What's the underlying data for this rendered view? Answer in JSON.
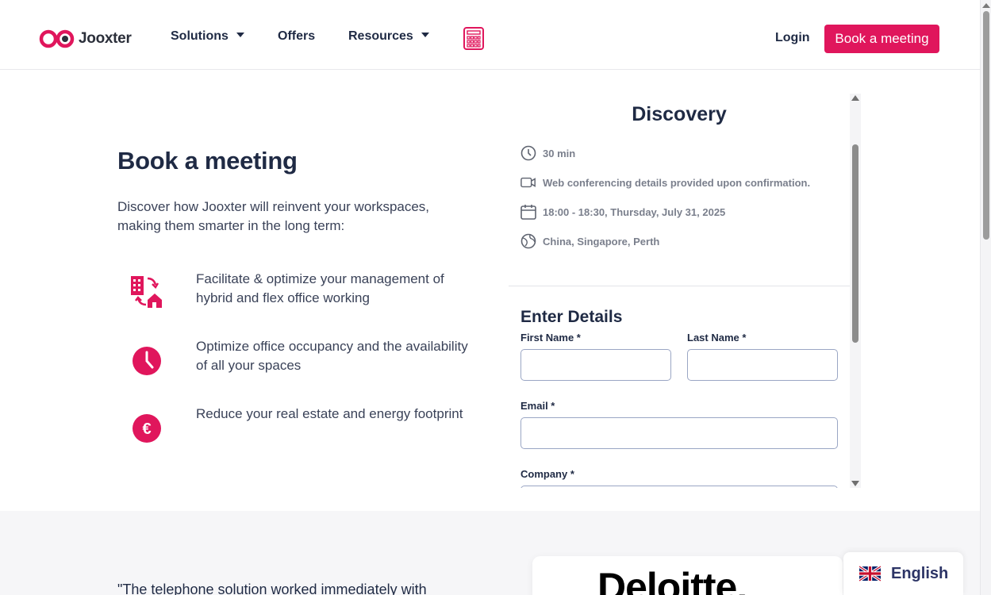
{
  "header": {
    "logo_text": "Jooxter",
    "nav": [
      {
        "label": "Solutions",
        "dropdown": true
      },
      {
        "label": "Offers",
        "dropdown": false
      },
      {
        "label": "Resources",
        "dropdown": true
      }
    ],
    "calculator_icon": "calculator-icon",
    "login_label": "Login",
    "cta_label": "Book a meeting"
  },
  "hero": {
    "title": "Book a meeting",
    "intro": "Discover how Jooxter will reinvent your workspaces, making them smarter in the long term:",
    "features": [
      {
        "icon": "hybrid-office-icon",
        "text": "Facilitate & optimize your management of hybrid and flex office working"
      },
      {
        "icon": "clock-icon",
        "text": "Optimize office occupancy and the availability of all your spaces"
      },
      {
        "icon": "euro-icon",
        "text": "Reduce your real estate and energy footprint"
      }
    ]
  },
  "booking": {
    "event_title": "Discovery",
    "meta": {
      "duration": "30 min",
      "conferencing": "Web conferencing details provided upon confirmation.",
      "datetime": "18:00 - 18:30, Thursday, July 31, 2025",
      "timezone": "China, Singapore, Perth"
    },
    "form_title": "Enter Details",
    "fields": {
      "first_name": {
        "label": "First Name *",
        "value": ""
      },
      "last_name": {
        "label": "Last Name *",
        "value": ""
      },
      "email": {
        "label": "Email *",
        "value": ""
      },
      "company": {
        "label": "Company *",
        "value": ""
      }
    }
  },
  "testimonial": {
    "quote": "\"The telephone solution worked immediately with",
    "brand": "Deloitte."
  },
  "language": {
    "label": "English",
    "flag": "uk-flag-icon"
  },
  "colors": {
    "accent": "#e0165c",
    "text": "#1f2a44",
    "muted": "#7a7f8c",
    "section_bg": "#f6f6f8"
  }
}
